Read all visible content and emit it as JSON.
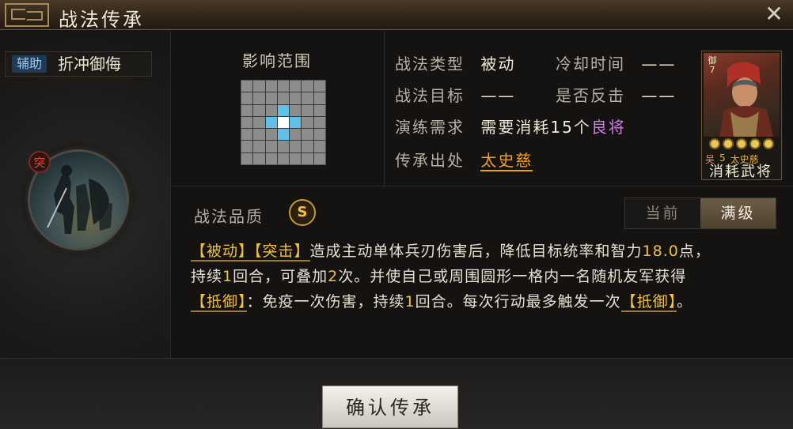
{
  "title": "战法传承",
  "skill": {
    "type_badge": "辅助",
    "name": "折冲御侮",
    "portrait_tag": "突"
  },
  "range": {
    "title": "影响范围",
    "grid_size": 7,
    "highlight_cells": [
      [
        2,
        3
      ],
      [
        3,
        2
      ],
      [
        3,
        3
      ],
      [
        3,
        4
      ],
      [
        4,
        3
      ]
    ],
    "center_cell": [
      3,
      3
    ]
  },
  "info": {
    "type_label": "战法类型",
    "type_value": "被动",
    "cooldown_label": "冷却时间",
    "cooldown_value": "——",
    "target_label": "战法目标",
    "target_value": "——",
    "counter_label": "是否反击",
    "counter_value": "——",
    "req_label": "演练需求",
    "req_prefix": "需要消耗",
    "req_count": "15",
    "req_unit": "个",
    "req_item": "良将",
    "source_label": "传承出处",
    "source_value": "太史慈"
  },
  "general": {
    "badge": "御7",
    "faction": "吴",
    "cost": "5",
    "name": "太史慈",
    "stars": 5,
    "caption": "消耗武将"
  },
  "quality": {
    "label": "战法品质",
    "grade": "S"
  },
  "tabs": {
    "current": "当前",
    "max": "满级"
  },
  "description": {
    "line1": [
      {
        "t": "【被动】",
        "kw": true
      },
      {
        "t": "【突击】",
        "kw": true
      },
      {
        "t": "造成主动单体兵刃伤害后，降低目标统率和智力",
        "kw": false
      },
      {
        "t": "18.0",
        "num": true
      },
      {
        "t": "点，",
        "kw": false
      }
    ],
    "line2": [
      {
        "t": "持续",
        "kw": false
      },
      {
        "t": "1",
        "num": true
      },
      {
        "t": "回合，可叠加",
        "kw": false
      },
      {
        "t": "2",
        "num": true
      },
      {
        "t": "次。并使自己或周围圆形一格内一名随机友军获得",
        "kw": false
      }
    ],
    "line3": [
      {
        "t": "【抵御】",
        "kw": true
      },
      {
        "t": "：免疫一次伤害，持续",
        "kw": false
      },
      {
        "t": "1",
        "num": true
      },
      {
        "t": "回合。每次行动最多触发一次",
        "kw": false
      },
      {
        "t": "【抵御】",
        "kw": true
      },
      {
        "t": "。",
        "kw": false
      }
    ]
  },
  "confirm_button": "确认传承",
  "colors": {
    "accent_gold": "#f0c040",
    "range_highlight": "#5fc0ea",
    "link_orange": "#f0a020",
    "purple": "#d07ce8"
  }
}
